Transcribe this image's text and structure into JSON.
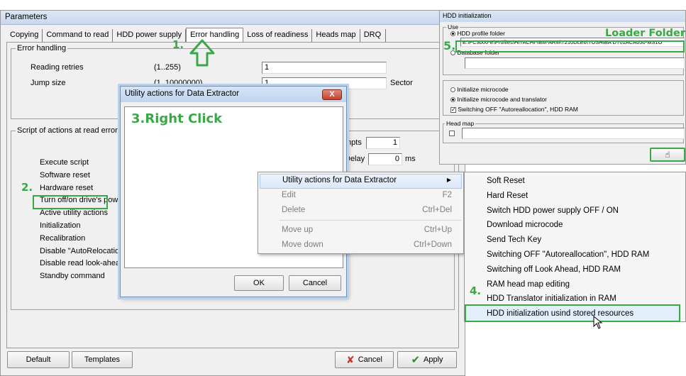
{
  "params": {
    "title": "Parameters",
    "tabs": [
      "Copying",
      "Command to read",
      "HDD power supply",
      "Error handling",
      "Loss of readiness",
      "Heads map",
      "DRQ"
    ],
    "error_handling": {
      "legend": "Error handling",
      "reading_retries_label": "Reading retries",
      "reading_retries_range": "(1..255)",
      "reading_retries_value": "1",
      "jump_size_label": "Jump size",
      "jump_size_range": "(1..10000000)",
      "jump_size_value": "1",
      "sector_label": "Sector"
    },
    "script": {
      "legend": "Script of actions at read error",
      "items": [
        "Execute script",
        "Software reset",
        "Hardware reset",
        "Turn off/on drive's power",
        "Active utility actions",
        "Initialization",
        "Recalibration",
        "Disable \"AutoRelocation\"",
        "Disable read look-ahead",
        "Standby command"
      ],
      "attempts_label": "mpts",
      "attempts_value": "1",
      "delay_label": "Delay",
      "delay_value": "0",
      "delay_unit": "ms"
    },
    "buttons": {
      "default": "Default",
      "templates": "Templates",
      "cancel": "Cancel",
      "apply": "Apply"
    }
  },
  "utility_dialog": {
    "title": "Utility actions for Data Extractor",
    "close": "X",
    "ok": "OK",
    "cancel": "Cancel"
  },
  "context_menu": [
    {
      "label": "Utility actions for Data Extractor",
      "shortcut": "",
      "has_submenu": true,
      "highlighted": true,
      "disabled": false
    },
    {
      "label": "Edit",
      "shortcut": "F2",
      "disabled": true
    },
    {
      "label": "Delete",
      "shortcut": "Ctrl+Del",
      "disabled": true
    },
    {
      "label": "Move up",
      "shortcut": "Ctrl+Up",
      "disabled": true
    },
    {
      "label": "Move down",
      "shortcut": "Ctrl+Down",
      "disabled": true
    }
  ],
  "submenu": [
    "Soft Reset",
    "Hard Reset",
    "Switch HDD power supply OFF / ON",
    "Download microcode",
    "Send Tech Key",
    "Switching OFF \"Autoreallocation\", HDD RAM",
    "Switching off Look Ahead, HDD RAM",
    "RAM head map editing",
    "HDD Translator initialization in RAM",
    "HDD initialization usind stored resources"
  ],
  "hdd_init": {
    "title": "HDD initialization",
    "use_legend": "Use",
    "profile_folder_label": "HDD profile folder",
    "profile_folder_path": "E:\\PC3000-E\\Profiles\\HITACHI-IBM-ARM\\7210DLE6\\TOSHIBA DT01ACA050-MS1O",
    "database_folder_label": "Database folder",
    "database_folder_path": "",
    "init_microcode": "Initialize microcode",
    "init_microcode_translator": "Initialize microcode and translator",
    "switching_off": "Switching OFF \"Autoreallocation\", HDD RAM",
    "head_map_legend": "Head map",
    "head_map_value": ""
  },
  "annotations": {
    "step1": "1.",
    "step2": "2.",
    "step3": "3.Right Click",
    "step4": "4.",
    "step5": "5.",
    "loader_folder": "Loader Folder"
  },
  "colors": {
    "annotation_green": "#3aa845",
    "cancel_red": "#c0392b",
    "apply_green": "#2e8b2e"
  }
}
